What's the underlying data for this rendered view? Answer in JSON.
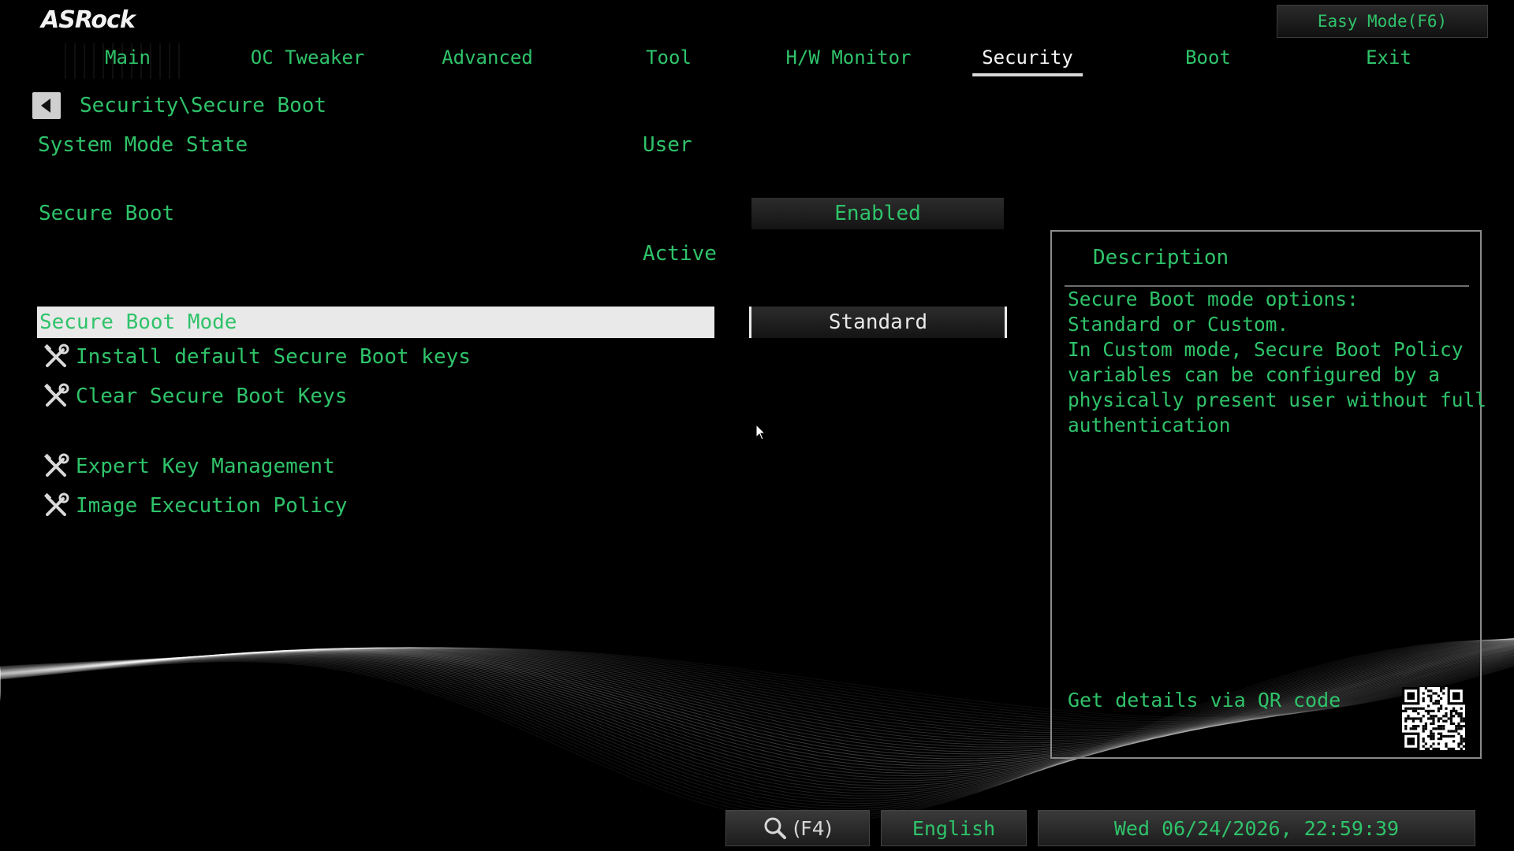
{
  "brand": {
    "logo": "ASRock"
  },
  "header": {
    "easy_mode": "Easy Mode(F6)"
  },
  "nav": {
    "tabs": [
      {
        "label": "Main"
      },
      {
        "label": "OC Tweaker"
      },
      {
        "label": "Advanced"
      },
      {
        "label": "Tool"
      },
      {
        "label": "H/W Monitor"
      },
      {
        "label": "Security"
      },
      {
        "label": "Boot"
      },
      {
        "label": "Exit"
      }
    ],
    "active_tab": "Security"
  },
  "breadcrumb": {
    "path": "Security\\Secure Boot"
  },
  "settings": {
    "system_mode_state": {
      "label": "System Mode State",
      "value": "User"
    },
    "secure_boot": {
      "label": "Secure Boot",
      "value": "Enabled",
      "status": "Active"
    },
    "secure_boot_mode": {
      "label": "Secure Boot Mode",
      "value": "Standard"
    },
    "actions": [
      {
        "label": "Install default Secure Boot keys",
        "icon": "tools-icon"
      },
      {
        "label": "Clear Secure Boot Keys",
        "icon": "tools-icon"
      },
      {
        "label": "Expert Key Management",
        "icon": "tools-icon"
      },
      {
        "label": "Image Execution Policy",
        "icon": "tools-icon"
      }
    ]
  },
  "description": {
    "title": "Description",
    "lines": [
      "Secure Boot mode options:",
      "Standard or Custom.",
      "In Custom mode, Secure Boot Policy",
      "variables can be configured by a",
      "physically present user without full",
      "authentication"
    ],
    "qr_label": "Get details via QR code"
  },
  "footer": {
    "search_label": "(F4)",
    "language": "English",
    "datetime": "Wed 06/24/2026, 22:59:39"
  },
  "colors": {
    "text_green": "#2fc36a",
    "background": "#000000",
    "highlight": "#e9e9e9"
  }
}
